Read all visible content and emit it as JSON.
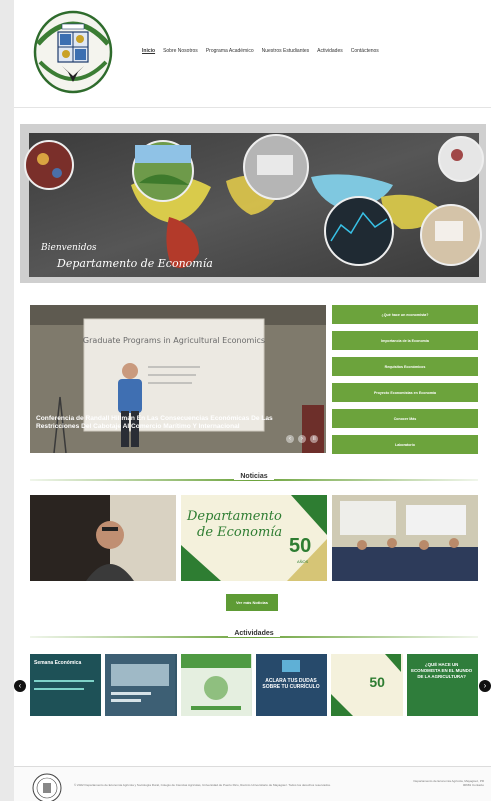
{
  "nav": {
    "items": [
      "Inicio",
      "Sobre Nosotros",
      "Programa Académico",
      "Nuestros Estudiantes",
      "Actividades",
      "Contáctenos"
    ]
  },
  "hero": {
    "line1": "Bienvenidos",
    "line2": "Departamento de Economía"
  },
  "featured": {
    "caption": "Conferencia de Randall Hillman En Las Consecuencias Económicas De Las Restricciones Del Cabotaje Al Comercio Marítimo Y Internacional",
    "slide_title": "Graduate Programs in Agricultural Economics"
  },
  "side_buttons": [
    "¿Qué hace un economista?",
    "Importancia de la Economía",
    "Requisitos Económicos",
    "Proyecto Economistas en Economía",
    "Conocer Más",
    "Laboratorio"
  ],
  "news": {
    "heading": "Noticias",
    "more_label": "Ver más Noticias",
    "card2_line1": "Departamento",
    "card2_line2": "de Economía",
    "card2_number": "50",
    "card2_years": "AÑOS"
  },
  "activities": {
    "heading": "Actividades",
    "cards": [
      {
        "text": "Semana Económica"
      },
      {
        "text": ""
      },
      {
        "text": ""
      },
      {
        "text": "ACLARA TUS DUDAS SOBRE TU CURRÍCULO"
      },
      {
        "text": "50"
      },
      {
        "text": "¿QUÉ HACE UN ECONOMISTA EN EL MUNDO DE LA AGRICULTURA?"
      }
    ],
    "prev_icon": "chevron-left-icon",
    "next_icon": "chevron-right-icon"
  },
  "footer": {
    "text": "© 2022 Departamento de Economía Agrícola y Sociología Rural, Colegio de Ciencias Agrícolas, Universidad de Puerto Rico, Recinto Universitario de Mayagüez. Todos los derechos reservados.",
    "contact": "Departamento de Economía Agrícola, Mayagüez, PR 00681 Contacto"
  },
  "colors": {
    "accent": "#6ca33c",
    "accent_dark": "#5e9b35",
    "hero_bg": "#4a4a4a"
  }
}
